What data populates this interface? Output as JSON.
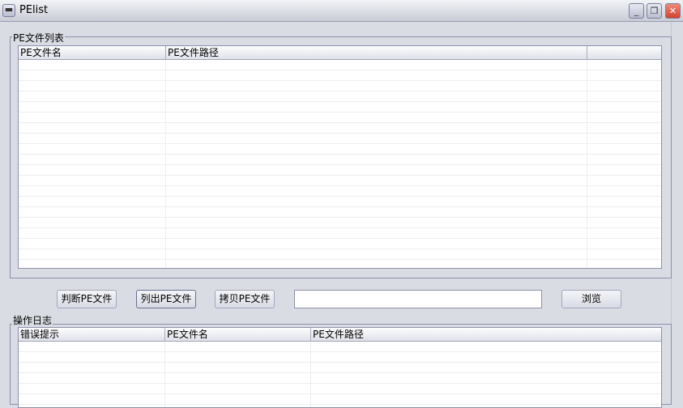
{
  "window": {
    "title": "PElist",
    "controls": {
      "minimize": "_",
      "maximize": "❐",
      "close": "✕"
    }
  },
  "pe_list": {
    "label": "PE文件列表",
    "columns": [
      "PE文件名",
      "PE文件路径",
      ""
    ]
  },
  "buttons": {
    "check": "判断PE文件",
    "list": "列出PE文件",
    "copy": "拷贝PE文件",
    "browse": "浏览"
  },
  "path_input": {
    "value": ""
  },
  "log": {
    "label": "操作日志",
    "columns": [
      "错误提示",
      "PE文件名",
      "PE文件路径"
    ]
  }
}
